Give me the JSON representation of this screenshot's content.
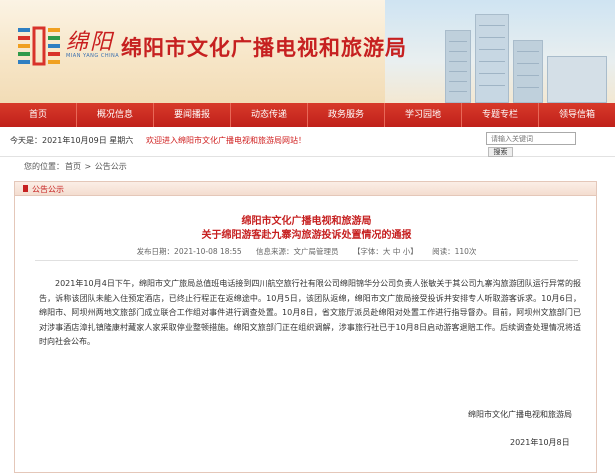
{
  "header": {
    "logo_text_cn": "绵阳",
    "logo_text_en": "MIAN YANG CHINA",
    "site_title": "绵阳市文化广播电视和旅游局"
  },
  "nav": {
    "items": [
      {
        "label": "首页"
      },
      {
        "label": "概况信息"
      },
      {
        "label": "要闻播报"
      },
      {
        "label": "动态传递"
      },
      {
        "label": "政务服务"
      },
      {
        "label": "学习园地"
      },
      {
        "label": "专题专栏"
      },
      {
        "label": "领导信箱"
      }
    ]
  },
  "infobar": {
    "date_text": "今天是：2021年10月09日 星期六",
    "welcome_text": "欢迎进入绵阳市文化广播电视和旅游局网站！",
    "search_placeholder": "请输入关键词",
    "search_button": "搜索"
  },
  "breadcrumb": {
    "prefix": "您的位置：",
    "items": [
      "首页",
      "公告公示"
    ],
    "separator": " > "
  },
  "panel": {
    "section_label": "公告公示"
  },
  "article": {
    "title_line1": "绵阳市文化广播电视和旅游局",
    "title_line2": "关于绵阳游客赴九寨沟旅游投诉处置情况的通报",
    "publish_time": "发布日期：2021-10-08 18:55",
    "source": "信息来源：文广局管理员",
    "font_size": "【字体：大 中 小】",
    "views": "阅读：110次",
    "body": "2021年10月4日下午，绵阳市文广旅局总值班电话接到四川航空旅行社有限公司绵阳锦华分公司负责人张敏关于其公司九寨沟旅游团队运行异常的报告，诉称该团队未能入住预定酒店，已终止行程正在返绵途中。10月5日，该团队返绵，绵阳市文广旅局接受投诉并安排专人听取游客诉求。10月6日，绵阳市、阿坝州两地文旅部门成立联合工作组对事件进行调查处置。10月8日，省文旅厅派员赴绵阳对处置工作进行指导督办。目前，阿坝州文旅部门已对涉事酒店漳扎镇隆康村藏家人家采取停业整顿措施。绵阳文旅部门正在组织调解，涉事旅行社已于10月8日启动游客退赔工作。后续调查处理情况将适时向社会公布。",
    "sign_org": "绵阳市文化广播电视和旅游局",
    "sign_date": "2021年10月8日"
  },
  "colors": {
    "brand_red": "#c62020",
    "nav_red": "#c0201a",
    "panel_border": "#e4c7b9"
  }
}
